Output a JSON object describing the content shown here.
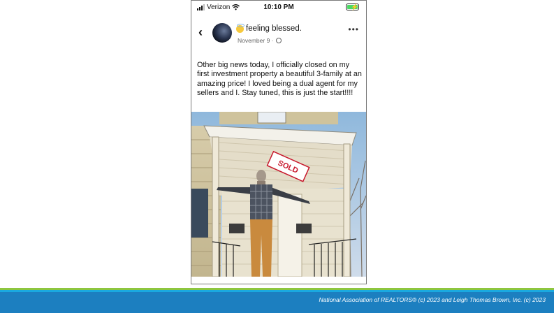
{
  "status_bar": {
    "carrier": "Verizon",
    "time": "10:10 PM"
  },
  "post": {
    "feeling_text": "feeling  blessed.",
    "date": "November 9 ·",
    "more_glyph": "•••",
    "body": "Other big news today, I officially closed on my first investment property a beautiful 3-family at an amazing price! I loved being a dual agent for my sellers and I. Stay tuned, this is just the start!!!!"
  },
  "photo": {
    "sign_text": "SOLD"
  },
  "footer": {
    "credit": "National Association of REALTORS® (c) 2023 and Leigh Thomas Brown, Inc. (c) 2023"
  },
  "colors": {
    "band_blue": "#1c7fc0",
    "stripe_green": "#8dc63f",
    "stripe_light_blue": "#1aa9e0",
    "sold_red": "#c8182c"
  },
  "icons": [
    "signal-icon",
    "wifi-icon",
    "battery-icon",
    "back-chevron-icon",
    "emoji-icon",
    "globe-icon",
    "more-options-icon"
  ]
}
